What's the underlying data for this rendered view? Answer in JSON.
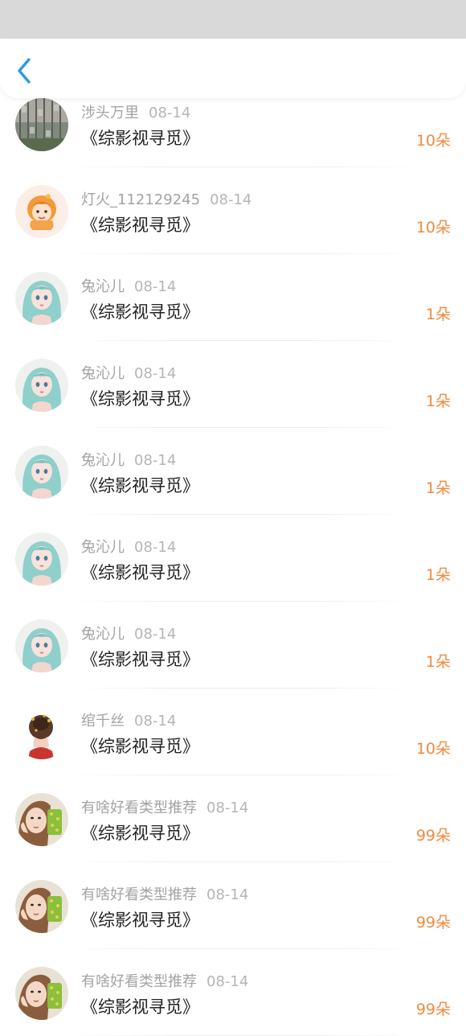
{
  "header": {
    "back_icon": "chevron-left-icon",
    "accent_color": "#2b9ae6"
  },
  "colors": {
    "amount": "#f08a3e",
    "meta": "#a3a3a3",
    "title": "#222222"
  },
  "items": [
    {
      "name": "涉头万里",
      "date": "08-14",
      "title": "《综影视寻觅》",
      "amount": "10朵",
      "avatar": "landscape-photo"
    },
    {
      "name": "灯火_112129245",
      "date": "08-14",
      "title": "《综影视寻觅》",
      "amount": "10朵",
      "avatar": "cartoon-girl"
    },
    {
      "name": "兔沁儿",
      "date": "08-14",
      "title": "《综影视寻觅》",
      "amount": "1朵",
      "avatar": "anime-girl-teal-hair"
    },
    {
      "name": "兔沁儿",
      "date": "08-14",
      "title": "《综影视寻觅》",
      "amount": "1朵",
      "avatar": "anime-girl-teal-hair"
    },
    {
      "name": "兔沁儿",
      "date": "08-14",
      "title": "《综影视寻觅》",
      "amount": "1朵",
      "avatar": "anime-girl-teal-hair"
    },
    {
      "name": "兔沁儿",
      "date": "08-14",
      "title": "《综影视寻觅》",
      "amount": "1朵",
      "avatar": "anime-girl-teal-hair"
    },
    {
      "name": "兔沁儿",
      "date": "08-14",
      "title": "《综影视寻觅》",
      "amount": "1朵",
      "avatar": "anime-girl-teal-hair"
    },
    {
      "name": "绾千丝",
      "date": "08-14",
      "title": "《综影视寻觅》",
      "amount": "10朵",
      "avatar": "hair-bun-back"
    },
    {
      "name": "有啥好看类型推荐",
      "date": "08-14",
      "title": "《综影视寻觅》",
      "amount": "99朵",
      "avatar": "selfie-girl-phone"
    },
    {
      "name": "有啥好看类型推荐",
      "date": "08-14",
      "title": "《综影视寻觅》",
      "amount": "99朵",
      "avatar": "selfie-girl-phone"
    },
    {
      "name": "有啥好看类型推荐",
      "date": "08-14",
      "title": "《综影视寻觅》",
      "amount": "99朵",
      "avatar": "selfie-girl-phone"
    }
  ]
}
